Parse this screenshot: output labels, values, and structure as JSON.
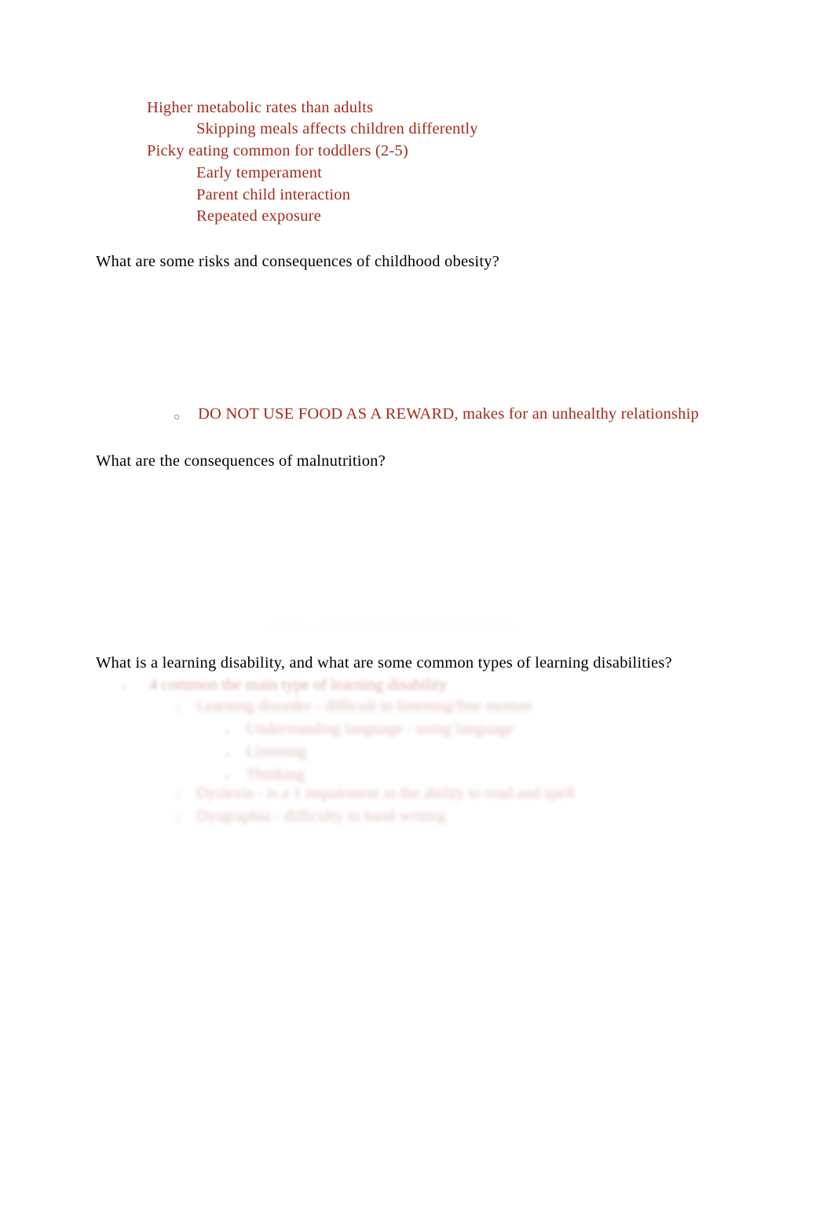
{
  "document": {
    "type": "study-notes-page",
    "background_color": "#ffffff",
    "question_color": "#000000",
    "answer_color": "#a32b1a"
  },
  "nutrition_notes": {
    "lines": [
      {
        "text": "Higher metabolic rates than adults",
        "indent": 1
      },
      {
        "text": "Skipping meals affects children differently",
        "indent": 2
      },
      {
        "text": "Picky eating common for toddlers (2-5)",
        "indent": 1
      },
      {
        "text": "Early temperament",
        "indent": 2
      },
      {
        "text": "Parent child interaction",
        "indent": 2
      },
      {
        "text": "Repeated exposure",
        "indent": 2
      }
    ]
  },
  "questions": {
    "obesity": "What are some risks and consequences of childhood obesity?",
    "malnutrition": "What are the consequences of malnutrition?",
    "learning_disability": "What is a learning disability, and what are some common types of learning disabilities?"
  },
  "obesity_answer": {
    "bullet_glyph": "○",
    "bullet_name": "hollow-circle-bullet",
    "text": "DO NOT USE FOOD AS A REWARD, makes for an unhealthy relationship"
  },
  "malnutrition_answer": {
    "smudge_text": "——— —————————————",
    "note": "answer area faded to near-invisible"
  },
  "learning_disability_answer": {
    "faded": true,
    "items": [
      {
        "bullet_glyph": "▪",
        "bullet_name": "square-bullet",
        "text": "4 common the main type of learning disability",
        "indent": 1
      },
      {
        "bullet_glyph": "□",
        "bullet_name": "open-square-bullet",
        "text": "Learning disorder - difficult in listening/fine motion",
        "indent": 2
      },
      {
        "bullet_glyph": "▪",
        "bullet_name": "square-bullet",
        "text": "Understanding language - using language",
        "indent": 3
      },
      {
        "bullet_glyph": "▪",
        "bullet_name": "square-bullet",
        "text": "Listening",
        "indent": 3
      },
      {
        "bullet_glyph": "▪",
        "bullet_name": "square-bullet",
        "text": "Thinking",
        "indent": 3
      },
      {
        "bullet_glyph": "□",
        "bullet_name": "open-square-bullet",
        "text": "Dyslexia - is a 1 impairment in the ability to read and spell",
        "indent": 2
      },
      {
        "bullet_glyph": "□",
        "bullet_name": "open-square-bullet",
        "text": "Dysgraphia - difficulty in hand writing",
        "indent": 2
      }
    ]
  }
}
